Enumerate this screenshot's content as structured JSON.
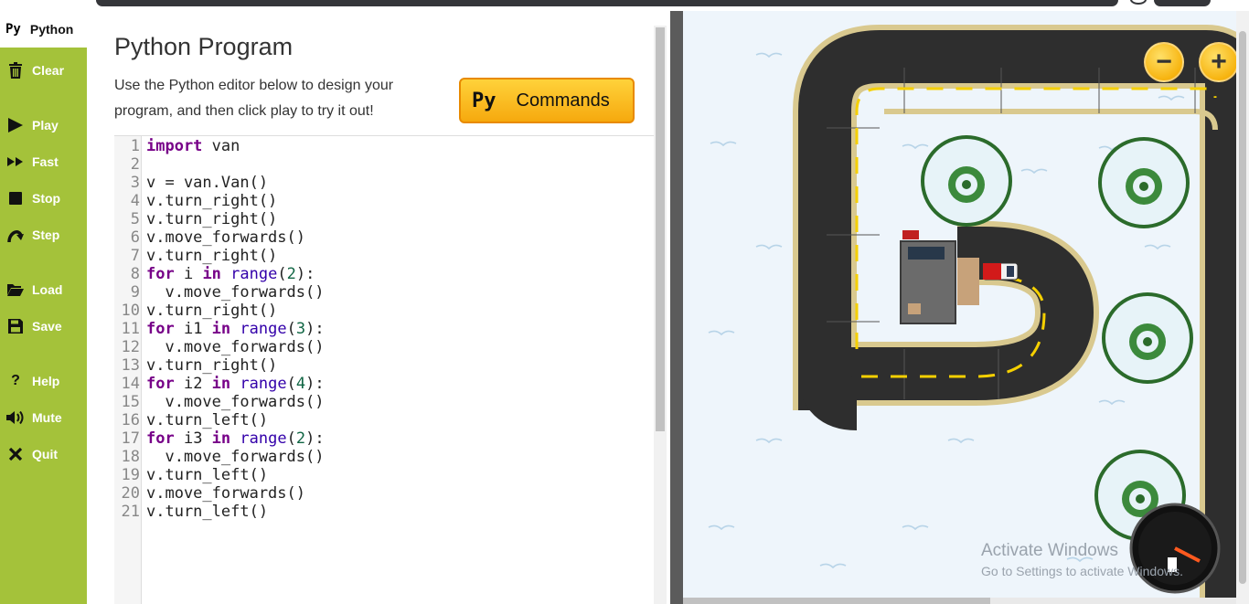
{
  "sidebar": {
    "tab_label": "Python",
    "tab_prefix": "Py",
    "items": [
      {
        "label": "Clear",
        "icon": "trash-icon"
      },
      {
        "label": "Play",
        "icon": "play-icon"
      },
      {
        "label": "Fast",
        "icon": "fast-forward-icon"
      },
      {
        "label": "Stop",
        "icon": "stop-icon"
      },
      {
        "label": "Step",
        "icon": "step-icon"
      },
      {
        "label": "Load",
        "icon": "folder-icon"
      },
      {
        "label": "Save",
        "icon": "save-icon"
      },
      {
        "label": "Help",
        "icon": "help-icon"
      },
      {
        "label": "Mute",
        "icon": "speaker-icon"
      },
      {
        "label": "Quit",
        "icon": "close-icon"
      }
    ]
  },
  "main": {
    "title": "Python Program",
    "description": "Use the Python editor below to design your program, and then click play to try it out!",
    "commands_prefix": "Py",
    "commands_label": "Commands"
  },
  "editor": {
    "lines": [
      "import van",
      "",
      "v = van.Van()",
      "v.turn_right()",
      "v.turn_right()",
      "v.move_forwards()",
      "v.turn_right()",
      "for i in range(2):",
      "  v.move_forwards()",
      "v.turn_right()",
      "for i1 in range(3):",
      "  v.move_forwards()",
      "v.turn_right()",
      "for i2 in range(4):",
      "  v.move_forwards()",
      "v.turn_left()",
      "for i3 in range(2):",
      "  v.move_forwards()",
      "v.turn_left()",
      "v.move_forwards()",
      "v.turn_left()"
    ]
  },
  "game": {
    "zoom_out": "−",
    "zoom_in": "+"
  },
  "watermark": {
    "line1": "Activate Windows",
    "line2": "Go to Settings to activate Windows."
  },
  "colors": {
    "sidebar": "#a4c23a",
    "accent": "#f6a90e",
    "road": "#2e2e2e",
    "lane": "#f5d000",
    "snow": "#eef5fb"
  }
}
